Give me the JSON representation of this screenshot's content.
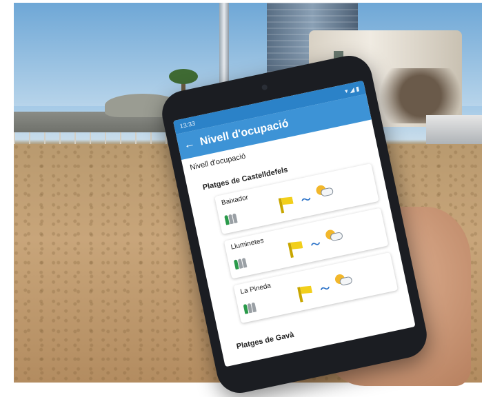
{
  "phone": {
    "status_time": "13:33",
    "status_right": "▾ ◢ ▮",
    "back_icon": "←",
    "title": "Nivell d'ocupació",
    "heading": "Nivell d'ocupació",
    "sections": [
      {
        "name": "Platges de Castelldefels",
        "beaches": [
          {
            "name": "Baixador",
            "occupancy_level": 1,
            "flag": "yellow"
          },
          {
            "name": "Lluminetes",
            "occupancy_level": 1,
            "flag": "yellow"
          },
          {
            "name": "La Pineda",
            "occupancy_level": 1,
            "flag": "yellow"
          }
        ]
      },
      {
        "name": "Platges de Gavà",
        "beaches": []
      }
    ],
    "wave_icon": "〜",
    "colors": {
      "primary": "#3d93d6",
      "status": "#2b82c8",
      "occupied": "#2a9a4a",
      "empty": "#9aa0a5",
      "flag": "#f2cf1b"
    }
  }
}
